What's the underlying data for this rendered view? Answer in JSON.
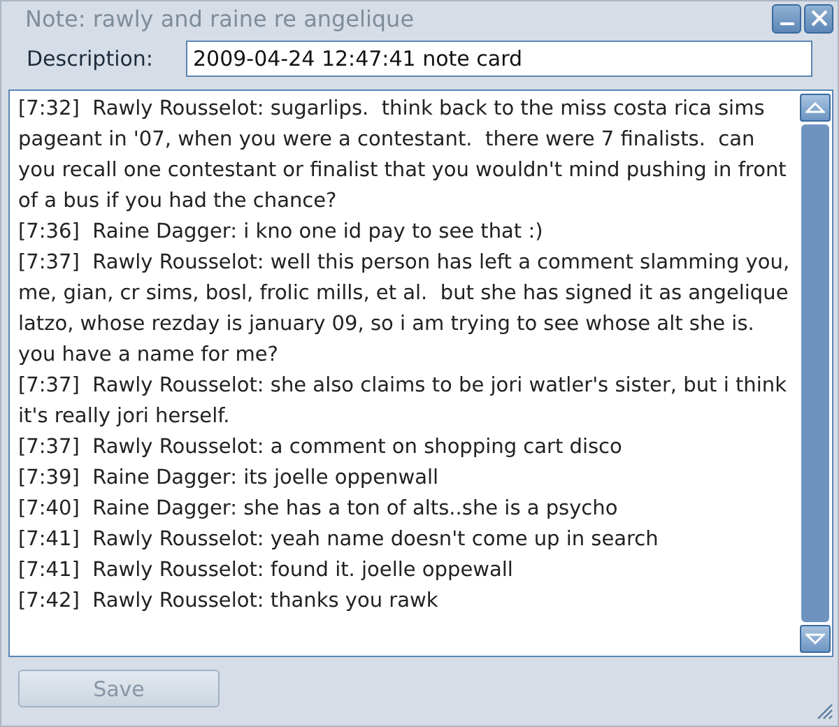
{
  "window": {
    "title": "Note: rawly and raine re angelique"
  },
  "description": {
    "label": "Description:",
    "value": "2009-04-24 12:47:41 note card"
  },
  "messages": [
    "[7:32]  Rawly Rousselot: sugarlips.  think back to the miss costa rica sims pageant in '07, when you were a contestant.  there were 7 finalists.  can you recall one contestant or finalist that you wouldn't mind pushing in front of a bus if you had the chance?",
    "[7:36]  Raine Dagger: i kno one id pay to see that :)",
    "[7:37]  Rawly Rousselot: well this person has left a comment slamming you, me, gian, cr sims, bosl, frolic mills, et al.  but she has signed it as angelique latzo, whose rezday is january 09, so i am trying to see whose alt she is.  you have a name for me?",
    "[7:37]  Rawly Rousselot: she also claims to be jori watler's sister, but i think it's really jori herself.",
    "[7:37]  Rawly Rousselot: a comment on shopping cart disco",
    "[7:39]  Raine Dagger: its joelle oppenwall",
    "[7:40]  Raine Dagger: she has a ton of alts..she is a psycho",
    "[7:41]  Rawly Rousselot: yeah name doesn't come up in search",
    "[7:41]  Rawly Rousselot: found it. joelle oppewall",
    "[7:42]  Rawly Rousselot: thanks you rawk"
  ],
  "save_button": {
    "label": "Save",
    "disabled": true
  }
}
